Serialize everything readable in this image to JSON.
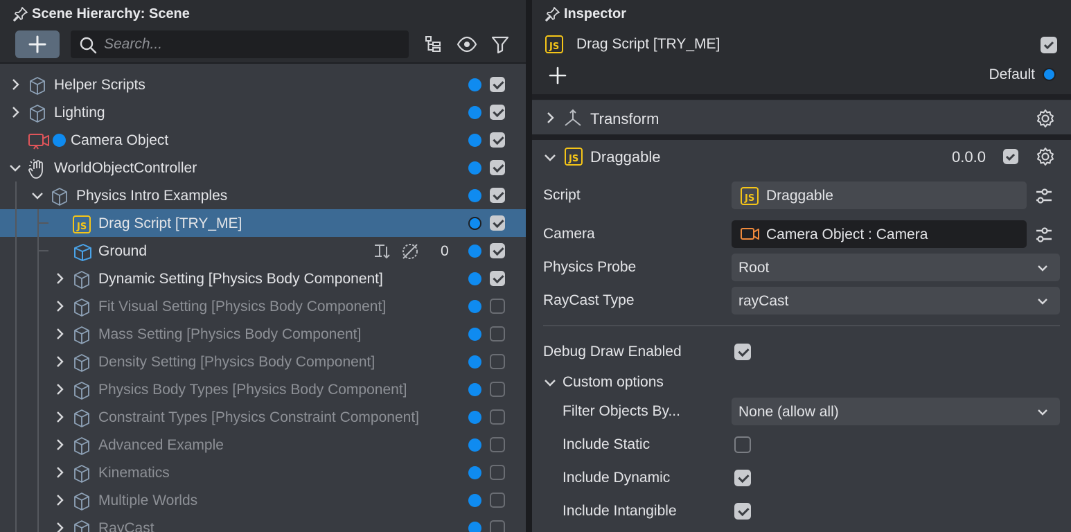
{
  "hierarchy": {
    "title": "Scene Hierarchy: Scene",
    "search_placeholder": "Search...",
    "items": [
      {
        "label": "Helper Scripts",
        "depth": 0,
        "expander": "collapsed",
        "icon": "object-cube-icon",
        "enabled": true,
        "dim": false
      },
      {
        "label": "Lighting",
        "depth": 0,
        "expander": "collapsed",
        "icon": "object-cube-icon",
        "enabled": true,
        "dim": false
      },
      {
        "label": "Camera Object",
        "depth": 0,
        "expander": "none",
        "icon": "camera-icon",
        "enabled": true,
        "dim": false
      },
      {
        "label": "WorldObjectController",
        "depth": 0,
        "expander": "expanded",
        "icon": "hand-gesture-icon",
        "enabled": true,
        "dim": false
      },
      {
        "label": "Physics Intro Examples",
        "depth": 1,
        "expander": "expanded",
        "icon": "object-cube-icon",
        "enabled": true,
        "dim": false
      },
      {
        "label": "Drag Script [TRY_ME]",
        "depth": 2,
        "expander": "none",
        "icon": "js-script-icon",
        "enabled": true,
        "dim": false,
        "selected": true
      },
      {
        "label": "Ground",
        "depth": 2,
        "expander": "none",
        "icon": "box-mesh-icon",
        "enabled": true,
        "dim": false,
        "count": "0"
      },
      {
        "label": "Dynamic Setting [Physics Body Component]",
        "depth": 2,
        "expander": "collapsed",
        "icon": "object-cube-icon",
        "enabled": true,
        "dim": false
      },
      {
        "label": "Fit Visual Setting [Physics Body Component]",
        "depth": 2,
        "expander": "collapsed",
        "icon": "object-cube-icon",
        "enabled": false,
        "dim": true
      },
      {
        "label": "Mass Setting [Physics Body Component]",
        "depth": 2,
        "expander": "collapsed",
        "icon": "object-cube-icon",
        "enabled": false,
        "dim": true
      },
      {
        "label": "Density Setting [Physics Body Component]",
        "depth": 2,
        "expander": "collapsed",
        "icon": "object-cube-icon",
        "enabled": false,
        "dim": true
      },
      {
        "label": "Physics Body Types [Physics Body Component]",
        "depth": 2,
        "expander": "collapsed",
        "icon": "object-cube-icon",
        "enabled": false,
        "dim": true
      },
      {
        "label": "Constraint Types [Physics Constraint Component]",
        "depth": 2,
        "expander": "collapsed",
        "icon": "object-cube-icon",
        "enabled": false,
        "dim": true
      },
      {
        "label": "Advanced Example",
        "depth": 2,
        "expander": "collapsed",
        "icon": "object-cube-icon",
        "enabled": false,
        "dim": true
      },
      {
        "label": "Kinematics",
        "depth": 2,
        "expander": "collapsed",
        "icon": "object-cube-icon",
        "enabled": false,
        "dim": true
      },
      {
        "label": "Multiple Worlds",
        "depth": 2,
        "expander": "collapsed",
        "icon": "object-cube-icon",
        "enabled": false,
        "dim": true
      },
      {
        "label": "RayCast",
        "depth": 2,
        "expander": "collapsed",
        "icon": "object-cube-icon",
        "enabled": false,
        "dim": true
      }
    ]
  },
  "inspector": {
    "title": "Inspector",
    "object_name": "Drag Script [TRY_ME]",
    "object_enabled": true,
    "layer_label": "Default",
    "transform": {
      "label": "Transform"
    },
    "draggable": {
      "label": "Draggable",
      "version": "0.0.0",
      "enabled": true,
      "fields": {
        "script_label": "Script",
        "script_value": "Draggable",
        "camera_label": "Camera",
        "camera_value": "Camera Object : Camera",
        "probe_label": "Physics Probe",
        "probe_value": "Root",
        "raycast_label": "RayCast Type",
        "raycast_value": "rayCast",
        "debug_label": "Debug Draw Enabled",
        "debug_checked": true,
        "custom_label": "Custom options",
        "filter_label": "Filter Objects By...",
        "filter_value": "None (allow all)",
        "static_label": "Include Static",
        "static_checked": false,
        "dynamic_label": "Include Dynamic",
        "dynamic_checked": true,
        "intangible_label": "Include Intangible",
        "intangible_checked": true
      }
    }
  },
  "colors": {
    "accent_blue": "#0f8bf0",
    "selection": "#3c6a94",
    "js_yellow": "#f5c518",
    "camera_red": "#e0555a",
    "camera_orange": "#f08a3c",
    "mesh_blue": "#4aa3e8"
  }
}
